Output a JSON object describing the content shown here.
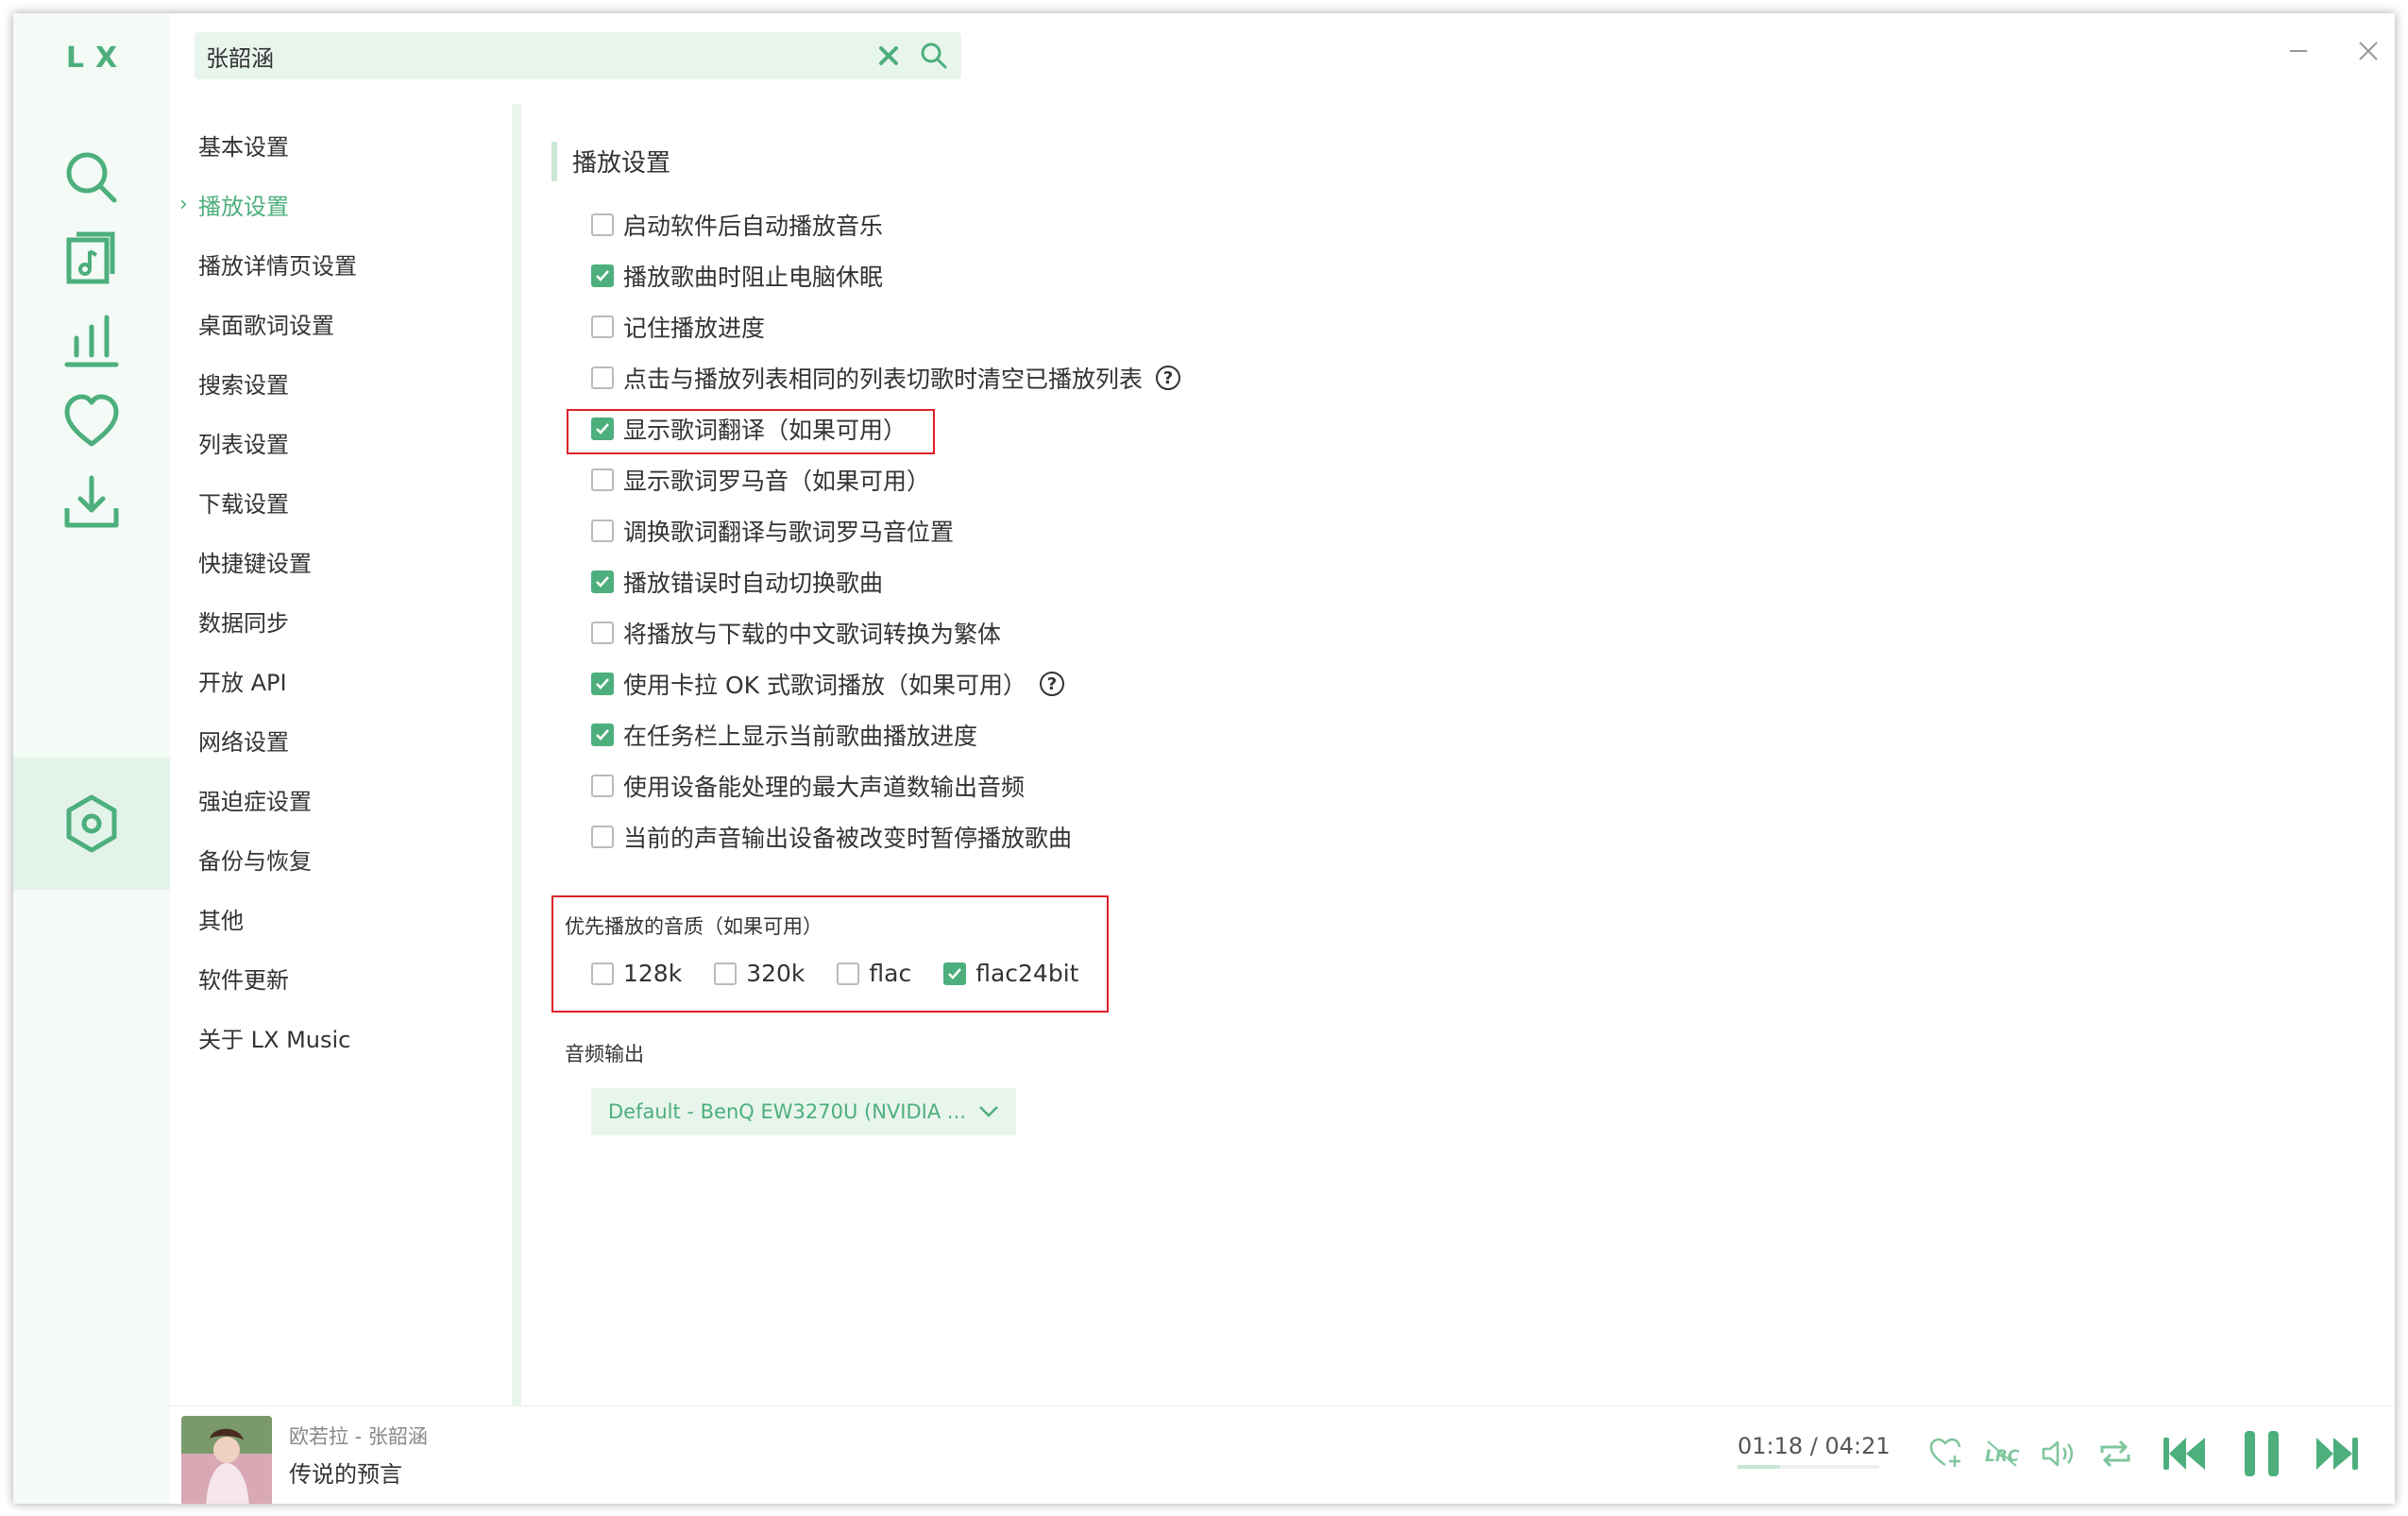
{
  "app": {
    "logo": "LX"
  },
  "nav": {
    "items": [
      {
        "name": "search"
      },
      {
        "name": "song-list"
      },
      {
        "name": "leaderboard"
      },
      {
        "name": "favorites"
      },
      {
        "name": "download"
      },
      {
        "name": "settings",
        "active": true
      }
    ]
  },
  "search": {
    "value": "张韶涵"
  },
  "menu": {
    "items": [
      {
        "label": "基本设置"
      },
      {
        "label": "播放设置",
        "active": true
      },
      {
        "label": "播放详情页设置"
      },
      {
        "label": "桌面歌词设置"
      },
      {
        "label": "搜索设置"
      },
      {
        "label": "列表设置"
      },
      {
        "label": "下载设置"
      },
      {
        "label": "快捷键设置"
      },
      {
        "label": "数据同步"
      },
      {
        "label": "开放 API"
      },
      {
        "label": "网络设置"
      },
      {
        "label": "强迫症设置"
      },
      {
        "label": "备份与恢复"
      },
      {
        "label": "其他"
      },
      {
        "label": "软件更新"
      },
      {
        "label": "关于 LX Music"
      }
    ]
  },
  "settings": {
    "section_title": "播放设置",
    "options": [
      {
        "label": "启动软件后自动播放音乐",
        "checked": false
      },
      {
        "label": "播放歌曲时阻止电脑休眠",
        "checked": true
      },
      {
        "label": "记住播放进度",
        "checked": false
      },
      {
        "label": "点击与播放列表相同的列表切歌时清空已播放列表",
        "checked": false,
        "help": true
      },
      {
        "label": "显示歌词翻译（如果可用）",
        "checked": true,
        "highlight": true
      },
      {
        "label": "显示歌词罗马音（如果可用）",
        "checked": false
      },
      {
        "label": "调换歌词翻译与歌词罗马音位置",
        "checked": false
      },
      {
        "label": "播放错误时自动切换歌曲",
        "checked": true
      },
      {
        "label": "将播放与下载的中文歌词转换为繁体",
        "checked": false
      },
      {
        "label": "使用卡拉 OK 式歌词播放（如果可用）",
        "checked": true,
        "help": true
      },
      {
        "label": "在任务栏上显示当前歌曲播放进度",
        "checked": true
      },
      {
        "label": "使用设备能处理的最大声道数输出音频",
        "checked": false
      },
      {
        "label": "当前的声音输出设备被改变时暂停播放歌曲",
        "checked": false
      }
    ],
    "quality": {
      "title": "优先播放的音质（如果可用）",
      "options": [
        {
          "label": "128k",
          "checked": false
        },
        {
          "label": "320k",
          "checked": false
        },
        {
          "label": "flac",
          "checked": false
        },
        {
          "label": "flac24bit",
          "checked": true
        }
      ]
    },
    "audio_output": {
      "title": "音频输出",
      "selected": "Default - BenQ EW3270U (NVIDIA ..."
    }
  },
  "player": {
    "artist_line": "欧若拉 - 张韶涵",
    "song": "传说的预言",
    "time": "01:18 / 04:21",
    "progress": 0.3
  },
  "colors": {
    "accent": "#4daf7c",
    "highlight_box": "#e0202a",
    "nav_bg": "#f4faf6"
  }
}
